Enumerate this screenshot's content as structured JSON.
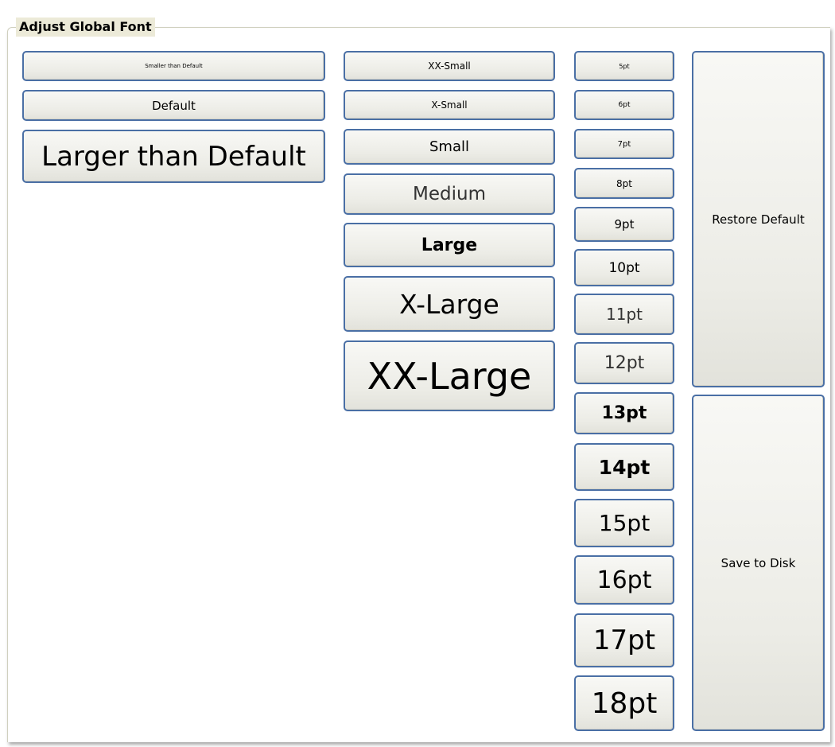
{
  "group_title": "Adjust Global Font",
  "relative_buttons": {
    "smaller": "Smaller than Default",
    "default": "Default",
    "larger": "Larger than Default"
  },
  "named_sizes": {
    "xx_small": "XX-Small",
    "x_small": "X-Small",
    "small": "Small",
    "medium": "Medium",
    "large": "Large",
    "x_large": "X-Large",
    "xx_large": "XX-Large"
  },
  "point_sizes": {
    "pt5": "5pt",
    "pt6": "6pt",
    "pt7": "7pt",
    "pt8": "8pt",
    "pt9": "9pt",
    "pt10": "10pt",
    "pt11": "11pt",
    "pt12": "12pt",
    "pt13": "13pt",
    "pt14": "14pt",
    "pt15": "15pt",
    "pt16": "16pt",
    "pt17": "17pt",
    "pt18": "18pt"
  },
  "actions": {
    "restore_default": "Restore Default",
    "save_to_disk": "Save to Disk"
  }
}
